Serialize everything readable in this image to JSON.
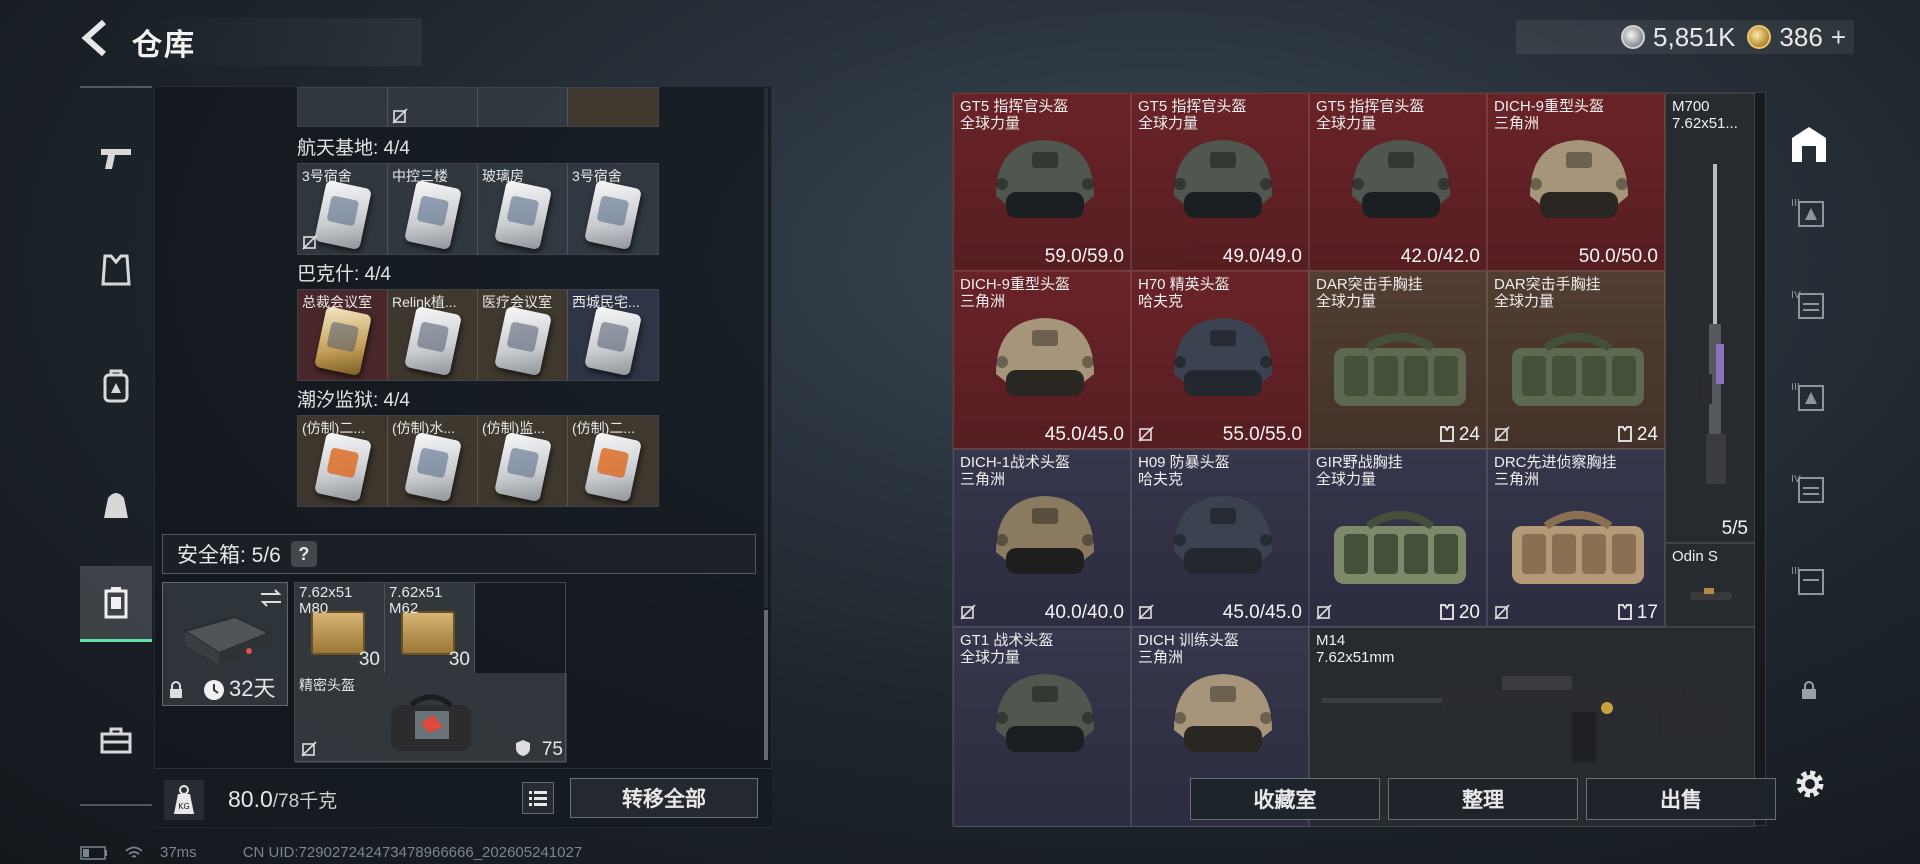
{
  "header": {
    "title": "仓库",
    "currency_coins": "5,851K",
    "currency_gold": "386",
    "currency_plus": "+"
  },
  "left_panel": {
    "top_row_labels": [
      "",
      "",
      "",
      ""
    ],
    "sections": [
      {
        "title": "航天基地: 4/4",
        "cells": [
          {
            "label": "3号宿舍"
          },
          {
            "label": "中控三楼"
          },
          {
            "label": "玻璃房"
          },
          {
            "label": "3号宿舍"
          }
        ]
      },
      {
        "title": "巴克什: 4/4",
        "cells": [
          {
            "label": "总裁会议室"
          },
          {
            "label": "Relink植..."
          },
          {
            "label": "医疗会议室"
          },
          {
            "label": "西城民宅..."
          }
        ]
      },
      {
        "title": "潮汐监狱: 4/4",
        "cells": [
          {
            "label": "(仿制)二..."
          },
          {
            "label": "(仿制)水..."
          },
          {
            "label": "(仿制)监..."
          },
          {
            "label": "(仿制)二..."
          }
        ]
      }
    ],
    "safe_box": {
      "header": "安全箱: 5/6",
      "help": "?",
      "days": "32天",
      "ammo": [
        {
          "line1": "7.62x51",
          "line2": "M80",
          "count": "30"
        },
        {
          "line1": "7.62x51",
          "line2": "M62",
          "count": "30"
        }
      ],
      "bag_label": "精密头盔",
      "bag_count": "75"
    },
    "weight": {
      "current": "80.0",
      "capacity": "/78千克"
    },
    "transfer_all": "转移全部"
  },
  "right_panel": {
    "items": [
      {
        "name": "GT5 指挥官头盔",
        "origin": "全球力量",
        "value": "59.0/59.0",
        "kind": "helmet",
        "tint": "red"
      },
      {
        "name": "GT5 指挥官头盔",
        "origin": "全球力量",
        "value": "49.0/49.0",
        "kind": "helmet",
        "tint": "red"
      },
      {
        "name": "GT5 指挥官头盔",
        "origin": "全球力量",
        "value": "42.0/42.0",
        "kind": "helmet",
        "tint": "red"
      },
      {
        "name": "DICH-9重型头盔",
        "origin": "三角洲",
        "value": "50.0/50.0",
        "kind": "helmet-tan",
        "tint": "red"
      },
      {
        "name": "DICH-9重型头盔",
        "origin": "三角洲",
        "value": "45.0/45.0",
        "kind": "helmet-tan",
        "tint": "red"
      },
      {
        "name": "H70 精英头盔",
        "origin": "哈夫克",
        "value": "55.0/55.0",
        "kind": "helmet-blue",
        "tint": "red"
      },
      {
        "name": "DAR突击手胸挂",
        "origin": "全球力量",
        "value": "24",
        "kind": "vest",
        "tint": "brown"
      },
      {
        "name": "DAR突击手胸挂",
        "origin": "全球力量",
        "value": "24",
        "kind": "vest",
        "tint": "brown"
      },
      {
        "name": "DICH-1战术头盔",
        "origin": "三角洲",
        "value": "40.0/40.0",
        "kind": "helmet-brown",
        "tint": "purple"
      },
      {
        "name": "H09 防暴头盔",
        "origin": "哈夫克",
        "value": "45.0/45.0",
        "kind": "helmet-blue",
        "tint": "purple"
      },
      {
        "name": "GIR野战胸挂",
        "origin": "全球力量",
        "value": "20",
        "kind": "vest-light",
        "tint": "purple"
      },
      {
        "name": "DRC先进侦察胸挂",
        "origin": "三角洲",
        "value": "17",
        "kind": "vest-tan",
        "tint": "purple"
      },
      {
        "name": "GT1 战术头盔",
        "origin": "全球力量",
        "value": "",
        "kind": "helmet",
        "tint": "purple"
      },
      {
        "name": "DICH 训练头盔",
        "origin": "三角洲",
        "value": "",
        "kind": "helmet-tan",
        "tint": "purple"
      }
    ],
    "rifle_long": {
      "name": "M700",
      "caliber": "7.62x51...",
      "count": "5/5"
    },
    "scope": {
      "name": "Odin S"
    },
    "rifle_wide": {
      "name": "M14",
      "caliber": "7.62x51mm"
    },
    "buttons": {
      "collection": "收藏室",
      "sort": "整理",
      "sell": "出售"
    }
  },
  "status": {
    "ping": "37ms",
    "uid": "CN UID:729027242473478966666_202605241027"
  }
}
